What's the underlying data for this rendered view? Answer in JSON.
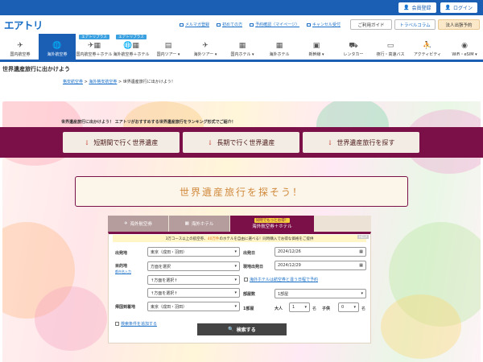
{
  "topbar": {
    "register": "会員登録",
    "login": "ログイン"
  },
  "header": {
    "logo": "エアトリ",
    "links": [
      "メルマガ登録",
      "初めての方",
      "予約確認（マイページ）",
      "キャンセル受付"
    ],
    "buttons": [
      "ご利用ガイド",
      "トラベルコラム",
      "法人出張予約"
    ]
  },
  "nav": [
    {
      "label": "国内航空券",
      "icon": "✈",
      "plus": ""
    },
    {
      "label": "海外航空券",
      "icon": "🌐",
      "plus": ""
    },
    {
      "label": "国内航空券＋ホテル",
      "icon": "✈▦",
      "plus": "エアトリプラス"
    },
    {
      "label": "海外航空券＋ホテル",
      "icon": "🌐▦",
      "plus": "エアトリプラス"
    },
    {
      "label": "国内ツアー ▾",
      "icon": "▤",
      "plus": ""
    },
    {
      "label": "海外ツアー ▾",
      "icon": "✈",
      "plus": ""
    },
    {
      "label": "国内ホテル ▾",
      "icon": "▦",
      "plus": ""
    },
    {
      "label": "海外ホテル",
      "icon": "▦",
      "plus": ""
    },
    {
      "label": "新幹線 ▾",
      "icon": "▣",
      "plus": ""
    },
    {
      "label": "レンタカー",
      "icon": "⛟",
      "plus": ""
    },
    {
      "label": "夜行・高速バス",
      "icon": "▭",
      "plus": ""
    },
    {
      "label": "アクティビティ",
      "icon": "⛹",
      "plus": ""
    },
    {
      "label": "WiFi・eSIM ▾",
      "icon": "◉",
      "plus": ""
    }
  ],
  "page": {
    "title": "世界遺産旅行に出かけよう",
    "breadcrumb": [
      "格安航空券",
      "海外格安航空券",
      "世界遺産旅行に出かけよう！"
    ],
    "hero_caption": "世界遺産旅行に出かけよう！ エアトリがおすすめする世界遺産旅行をランキング形式でご紹介！",
    "anchor_buttons": [
      "短期間で行く世界遺産",
      "長期で行く世界遺産",
      "世界遺産旅行を探す"
    ],
    "banner": "世界遺産旅行を探そう！"
  },
  "search": {
    "tabs": [
      {
        "label": "海外航空券"
      },
      {
        "label": "海外ホテル"
      },
      {
        "label": "海外航空券＋ホテル",
        "sub": "同時でもっとお得！"
      }
    ],
    "note": {
      "prefix": "3万コース以上の航空券、",
      "highlight": "40万件",
      "suffix": "のホテルを自由に選べる！同時購入でお得な価格をご提供",
      "help": "HELP"
    },
    "from_label": "出発地",
    "from_value": "東京（成田・羽田）",
    "dest_label": "目的地",
    "dest_sub": "都市名入力",
    "dest_values": [
      "方面を選択",
      "↑方面を選択↑",
      "↑方面を選択↑"
    ],
    "return_label": "帰国到着地",
    "return_value": "東京（成田・羽田）",
    "depart_label": "出発日",
    "depart_value": "2024/12/26",
    "hotelout_label": "現地出発日",
    "hotelout_value": "2024/12/29",
    "diff_dates": "海外ホテルは航空券と違う日程で予約",
    "rooms_label": "部屋数",
    "rooms_value": "1部屋",
    "room1_label": "1部屋",
    "adult_label": "大人",
    "adult_value": "1",
    "unit": "名",
    "child_label": "子供",
    "child_value": "0",
    "add_cond": "検索条件を追加する",
    "search_btn": "検索する"
  }
}
